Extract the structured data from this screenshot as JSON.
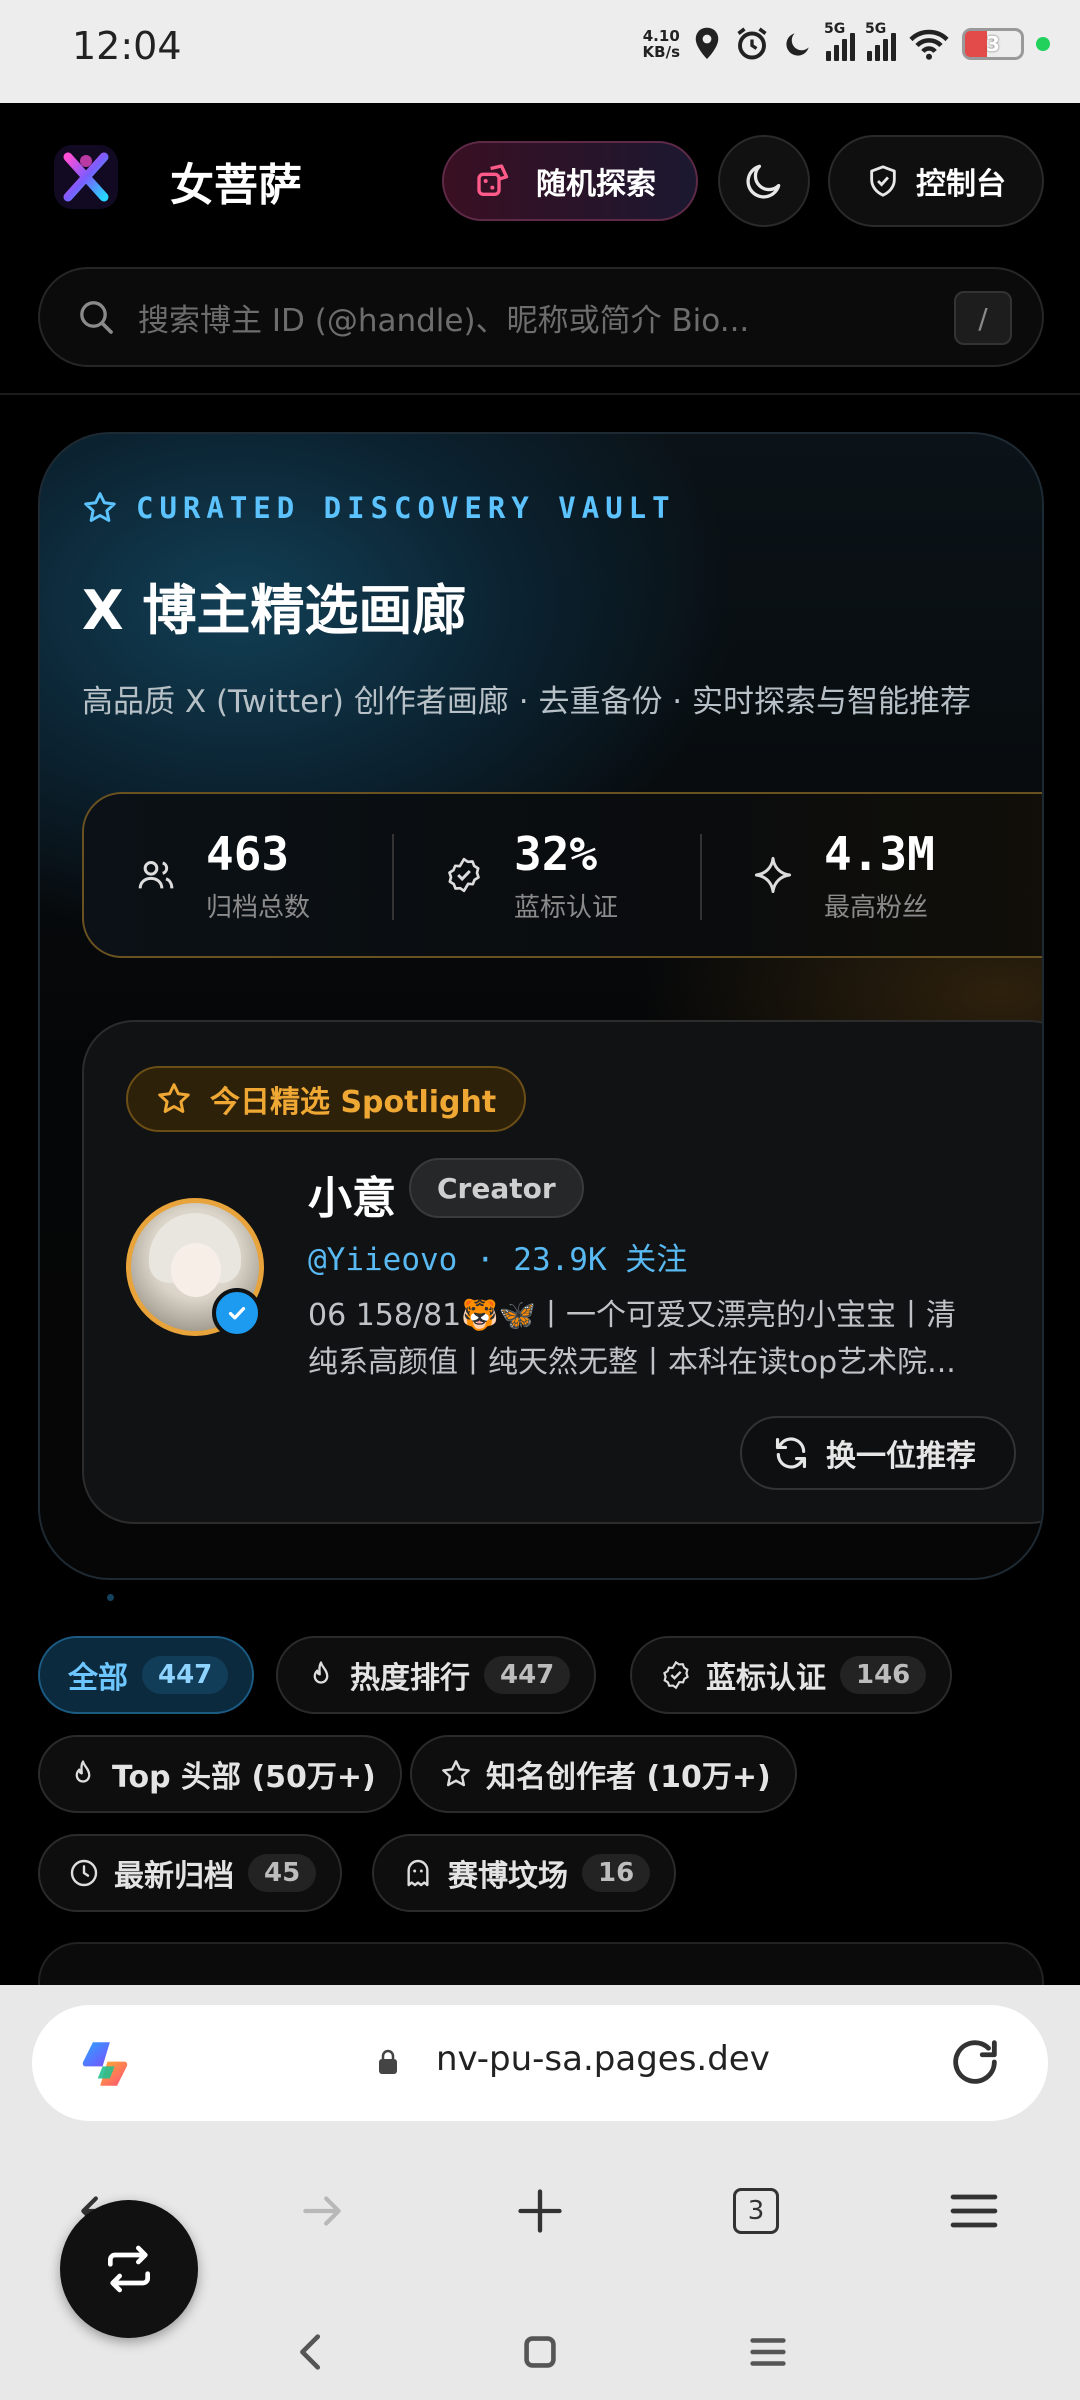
{
  "status_bar": {
    "time": "12:04",
    "net_speed": "4.10",
    "net_unit": "KB/s",
    "sim1_label": "5G",
    "sim2_label": "5G",
    "battery": "3"
  },
  "header": {
    "app_name": "女菩萨",
    "random_button": "随机探索",
    "console_button": "控制台",
    "search_placeholder": "搜索博主 ID (@handle)、昵称或简介 Bio...",
    "search_shortcut": "/"
  },
  "hero": {
    "eyebrow": "CURATED DISCOVERY VAULT",
    "title": "X 博主精选画廊",
    "subtitle": "高品质 X (Twitter) 创作者画廊 · 去重备份 · 实时探索与智能推荐",
    "stats": [
      {
        "value": "463",
        "label": "归档总数",
        "icon": "users-icon"
      },
      {
        "value": "32%",
        "label": "蓝标认证",
        "icon": "badge-check-icon"
      },
      {
        "value": "4.3M",
        "label": "最高粉丝",
        "icon": "sparkle-icon"
      }
    ]
  },
  "spotlight": {
    "badge": "今日精选 Spotlight",
    "name": "小意",
    "tag": "Creator",
    "handle_line": "@Yiieovo · 23.9K 关注",
    "bio_line1": "06 158/81🐯🦋丨一个可爱又漂亮的小宝宝丨清",
    "bio_line2": "纯系高颜值丨纯天然无整丨本科在读top艺术院...",
    "swap_button": "换一位推荐"
  },
  "filters": [
    {
      "label": "全部",
      "count": "447",
      "icon": "none",
      "active": true
    },
    {
      "label": "热度排行",
      "count": "447",
      "icon": "flame-icon"
    },
    {
      "label": "蓝标认证",
      "count": "146",
      "icon": "badge-check-icon"
    },
    {
      "label": "Top 头部 (50万+)",
      "count": "",
      "icon": "flame-icon"
    },
    {
      "label": "知名创作者 (10万+)",
      "count": "",
      "icon": "star-icon"
    },
    {
      "label": "最新归档",
      "count": "45",
      "icon": "clock-icon"
    },
    {
      "label": "赛博坟场",
      "count": "16",
      "icon": "ghost-icon"
    }
  ],
  "browser": {
    "url": "nv-pu-sa.pages.dev",
    "tab_count": "3"
  },
  "colors": {
    "accent_blue": "#5cc3ff",
    "accent_gold": "#f0a835",
    "verified_blue": "#1d9bf0"
  }
}
